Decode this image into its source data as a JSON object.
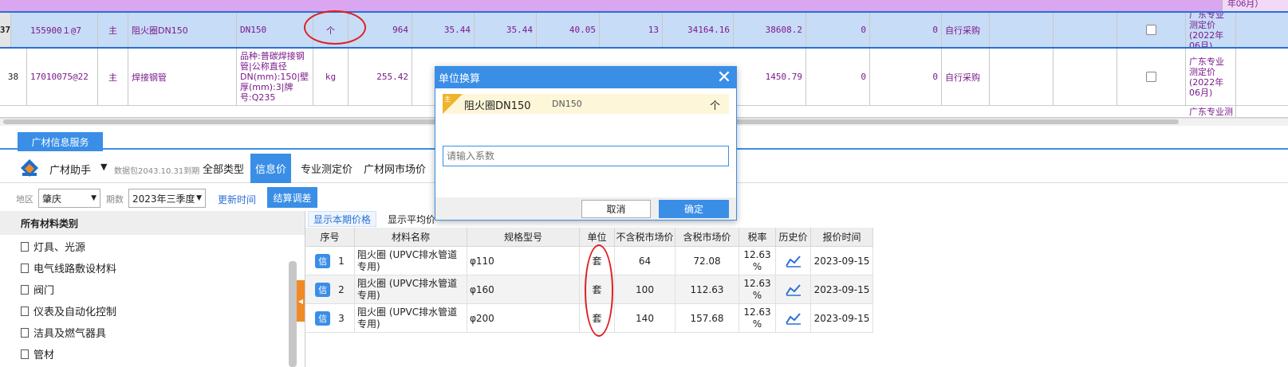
{
  "grid": {
    "top_right_text": "年06月）",
    "row37": {
      "rownum": "37",
      "code": "155900１@7",
      "type": "主",
      "name": "阻火圈DN150",
      "spec": "DN150",
      "unit": "个",
      "qty": "964",
      "p1": "35.44",
      "p2": "35.44",
      "p3": "40.05",
      "rate": "13",
      "amt1": "34164.16",
      "amt2": "38608.2",
      "z1": "0",
      "z2": "0",
      "supply": "自行采购",
      "note": "广东专业测定价(2022年06月)"
    },
    "row38": {
      "rownum": "38",
      "code": "17010075@22",
      "type": "主",
      "name": "焊接钢管",
      "spec": "品种:普碳焊接钢管|公称直径DN(mm):150|壁厚(mm):3|牌号:Q235",
      "unit": "kg",
      "qty": "255.42",
      "amt2": "1450.79",
      "z1": "0",
      "z2": "0",
      "supply": "自行采购",
      "note": "广东专业测定价(2022年06月)"
    },
    "row39": {
      "note": "广东专业测"
    }
  },
  "panel": {
    "tab": "广材信息服务",
    "brand": "广材助手",
    "package": "数据包2043.10.31到期",
    "filter_tabs": [
      "全部类型",
      "信息价",
      "专业测定价",
      "广材网市场价"
    ],
    "region_label": "地区",
    "region": "肇庆",
    "period_label": "期数",
    "period": "2023年三季度",
    "update_time": "更新时间",
    "settle": "结算调差",
    "left_head": "所有材料类别",
    "categories": [
      "灯具、光源",
      "电气线路敷设材料",
      "阀门",
      "仪表及自动化控制",
      "洁具及燃气器具",
      "管材"
    ],
    "subtabs": [
      "显示本期价格",
      "显示平均价"
    ],
    "table": {
      "headers": [
        "序号",
        "材料名称",
        "规格型号",
        "单位",
        "不含税市场价",
        "含税市场价",
        "税率",
        "历史价",
        "报价时间"
      ],
      "rows": [
        {
          "badge": "信",
          "no": "1",
          "name": "阻火圈 (UPVC排水管道专用)",
          "spec": "φ110",
          "unit": "套",
          "p": "64",
          "pt": "72.08",
          "rate": "12.63 %",
          "date": "2023-09-15"
        },
        {
          "badge": "信",
          "no": "2",
          "name": "阻火圈 (UPVC排水管道专用)",
          "spec": "φ160",
          "unit": "套",
          "p": "100",
          "pt": "112.63",
          "rate": "12.63 %",
          "date": "2023-09-15"
        },
        {
          "badge": "信",
          "no": "3",
          "name": "阻火圈 (UPVC排水管道专用)",
          "spec": "φ200",
          "unit": "套",
          "p": "140",
          "pt": "157.68",
          "rate": "12.63 %",
          "date": "2023-09-15"
        }
      ]
    }
  },
  "dialog": {
    "title": "单位换算",
    "tag": "主",
    "item_name": "阻火圈DN150",
    "item_spec": "DN150",
    "item_unit": "个",
    "input_placeholder": "请输入系数",
    "cancel": "取消",
    "ok": "确定"
  },
  "colors": {
    "accent": "#3a8ee6",
    "highlight": "#e02020",
    "purple_text": "#7a1a8a"
  }
}
